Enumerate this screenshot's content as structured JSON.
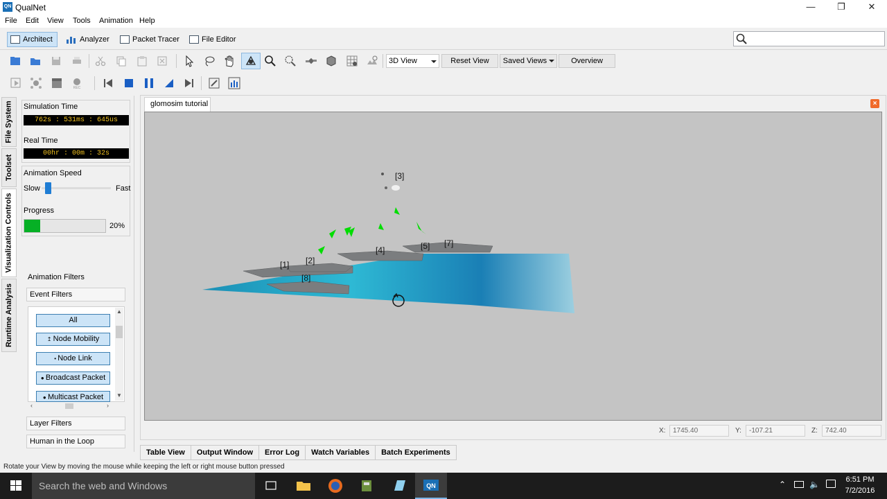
{
  "window": {
    "title": "QualNet"
  },
  "menu": [
    "File",
    "Edit",
    "View",
    "Tools",
    "Animation",
    "Help"
  ],
  "perspectives": [
    "Architect",
    "Analyzer",
    "Packet Tracer",
    "File Editor"
  ],
  "search": {
    "placeholder": ""
  },
  "toolbar": {
    "view_mode": "3D View",
    "reset_view": "Reset View",
    "saved_views": "Saved Views",
    "overview": "Overview"
  },
  "vertical_tabs": [
    "File System",
    "Toolset",
    "Visualization Controls",
    "Runtime Analysis"
  ],
  "sim": {
    "sim_time_label": "Simulation Time",
    "sim_time": "762s : 531ms : 645us",
    "real_time_label": "Real Time",
    "real_time": "00hr : 00m : 32s",
    "anim_speed_label": "Animation Speed",
    "slow": "Slow",
    "fast": "Fast",
    "speed_level": 0.05,
    "progress_label": "Progress",
    "progress": "20%",
    "progress_value": 20
  },
  "filters": {
    "title": "Animation Filters",
    "event_filters": "Event Filters",
    "items": [
      "All",
      "Node Mobility",
      "Node Link",
      "Broadcast Packet",
      "Multicast Packet"
    ],
    "layer_filters": "Layer Filters",
    "human_in_loop": "Human in the Loop"
  },
  "document": {
    "tab": "glomosim tutorial"
  },
  "nodes": [
    "[1]",
    "[2]",
    "[3]",
    "[4]",
    "[5]",
    "[7]",
    "[8]"
  ],
  "coords": {
    "x_label": "X:",
    "x": "1745.40",
    "y_label": "Y:",
    "y": "-107.21",
    "z_label": "Z:",
    "z": "742.40"
  },
  "bottom_tabs": [
    "Table View",
    "Output Window",
    "Error Log",
    "Watch Variables",
    "Batch Experiments"
  ],
  "status": "Rotate your View by moving the mouse while keeping the left or right mouse button pressed",
  "taskbar": {
    "search": "Search the web and Windows",
    "time": "6:51 PM",
    "date": "7/2/2016"
  }
}
